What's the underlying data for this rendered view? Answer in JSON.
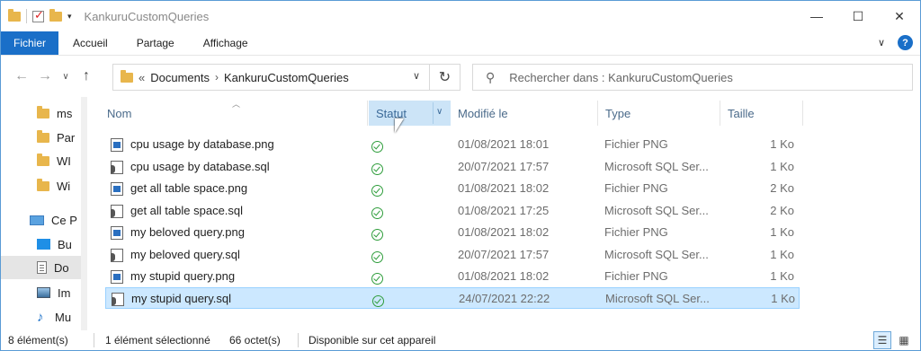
{
  "window": {
    "title": "KankuruCustomQueries"
  },
  "window_buttons": {
    "minimize": "—",
    "maximize": "☐",
    "close": "✕"
  },
  "ribbon": {
    "tabs": [
      "Fichier",
      "Accueil",
      "Partage",
      "Affichage"
    ],
    "help": "?"
  },
  "nav": {
    "back": "←",
    "forward": "→",
    "recent": "∨",
    "up": "↑",
    "address": {
      "prefix": "«",
      "crumbs": [
        "Documents",
        "KankuruCustomQueries"
      ],
      "separator": "›"
    },
    "refresh": "↻",
    "search_placeholder": "Rechercher dans : KankuruCustomQueries"
  },
  "sidebar": {
    "items": [
      {
        "label": "ms",
        "icon": "folder-icon"
      },
      {
        "label": "Par",
        "icon": "folder-icon"
      },
      {
        "label": "WI",
        "icon": "folder-icon"
      },
      {
        "label": "Wi",
        "icon": "folder-icon"
      },
      {
        "label": "Ce P",
        "icon": "pc-icon"
      },
      {
        "label": "Bu",
        "icon": "desktop-icon"
      },
      {
        "label": "Do",
        "icon": "documents-icon",
        "selected": true
      },
      {
        "label": "Im",
        "icon": "pictures-icon"
      },
      {
        "label": "Mu",
        "icon": "music-icon"
      }
    ]
  },
  "columns": {
    "name": "Nom",
    "status": "Statut",
    "modified": "Modifié le",
    "type": "Type",
    "size": "Taille"
  },
  "files": [
    {
      "name": "cpu usage by database.png",
      "kind": "png",
      "modified": "01/08/2021 18:01",
      "type": "Fichier PNG",
      "size": "1 Ko"
    },
    {
      "name": "cpu usage by database.sql",
      "kind": "sql",
      "modified": "20/07/2021 17:57",
      "type": "Microsoft SQL Ser...",
      "size": "1 Ko"
    },
    {
      "name": "get all table space.png",
      "kind": "png",
      "modified": "01/08/2021 18:02",
      "type": "Fichier PNG",
      "size": "2 Ko"
    },
    {
      "name": "get all table space.sql",
      "kind": "sql",
      "modified": "01/08/2021 17:25",
      "type": "Microsoft SQL Ser...",
      "size": "2 Ko"
    },
    {
      "name": "my beloved query.png",
      "kind": "png",
      "modified": "01/08/2021 18:02",
      "type": "Fichier PNG",
      "size": "1 Ko"
    },
    {
      "name": "my beloved query.sql",
      "kind": "sql",
      "modified": "20/07/2021 17:57",
      "type": "Microsoft SQL Ser...",
      "size": "1 Ko"
    },
    {
      "name": "my stupid query.png",
      "kind": "png",
      "modified": "01/08/2021 18:02",
      "type": "Fichier PNG",
      "size": "1 Ko"
    },
    {
      "name": "my stupid query.sql",
      "kind": "sql",
      "modified": "24/07/2021 22:22",
      "type": "Microsoft SQL Ser...",
      "size": "1 Ko",
      "selected": true
    }
  ],
  "status_bar": {
    "count": "8 élément(s)",
    "selected": "1 élément sélectionné",
    "size": "66 octet(s)",
    "availability": "Disponible sur cet appareil"
  },
  "colors": {
    "accent": "#1a6fc8",
    "selection": "#cce8ff",
    "status_ok": "#2e9d3b"
  }
}
